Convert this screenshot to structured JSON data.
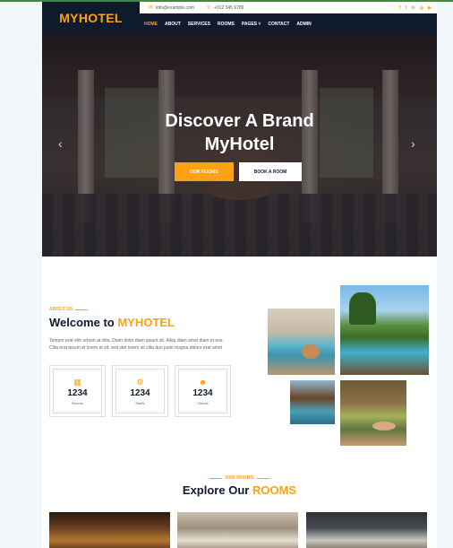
{
  "brand": {
    "name": "MYHOTEL",
    "accent_color": "#fea116",
    "dark_color": "#0f1b2c"
  },
  "topbar": {
    "email": "info@example.com",
    "email_icon": "envelope-icon",
    "phone": "+012 345 6789",
    "phone_icon": "phone-icon",
    "socials": [
      {
        "icon": "facebook-icon",
        "glyph": "f"
      },
      {
        "icon": "twitter-icon",
        "glyph": "t"
      },
      {
        "icon": "linkedin-icon",
        "glyph": "in"
      },
      {
        "icon": "instagram-icon",
        "glyph": "◎"
      },
      {
        "icon": "youtube-icon",
        "glyph": "▶"
      }
    ]
  },
  "nav": {
    "items": [
      {
        "label": "HOME",
        "active": true
      },
      {
        "label": "ABOUT"
      },
      {
        "label": "SERVICES"
      },
      {
        "label": "ROOMS"
      },
      {
        "label": "PAGES ˅"
      },
      {
        "label": "CONTACT"
      },
      {
        "label": "ADMIN"
      }
    ]
  },
  "hero": {
    "title_line1": "Discover A Brand",
    "title_line2": "MyHotel",
    "primary_button": "OUR ROOMS",
    "secondary_button": "BOOK A ROOM",
    "prev_icon": "chevron-left-icon",
    "next_icon": "chevron-right-icon"
  },
  "about": {
    "subtitle": "ABOUT US",
    "title_prefix": "Welcome to",
    "title_accent": "MYHOTEL",
    "text": "Tempor erat elitr rebum at clita. Diam dolor diam ipsum sit. Aliqu diam amet diam et eos. Clita erat ipsum et lorem et sit, sed stet lorem sit clita duo justo magna dolore erat amet",
    "stats": [
      {
        "icon": "hotel-icon",
        "glyph": "▦",
        "value": "1234",
        "label": "Rooms"
      },
      {
        "icon": "users-cog-icon",
        "glyph": "⚙",
        "value": "1234",
        "label": "Staffs"
      },
      {
        "icon": "users-icon",
        "glyph": "☻",
        "value": "1234",
        "label": "Clients"
      }
    ]
  },
  "rooms": {
    "subtitle": "OUR ROOMS",
    "title_prefix": "Explore Our",
    "title_accent": "ROOMS"
  }
}
